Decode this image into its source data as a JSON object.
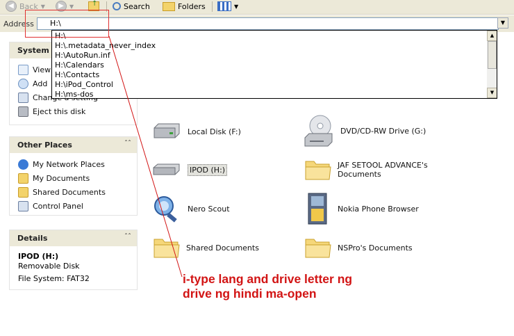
{
  "toolbar": {
    "back_label": "Back",
    "search_label": "Search",
    "folders_label": "Folders"
  },
  "address": {
    "label": "Address",
    "value": "H:\\"
  },
  "dropdown": {
    "items": [
      "H:\\",
      "H:\\.metadata_never_index",
      "H:\\AutoRun.inf",
      "H:\\Calendars",
      "H:\\Contacts",
      "H:\\iPod_Control",
      "H:\\ms-dos"
    ]
  },
  "left": {
    "system_tasks": {
      "title": "System",
      "items": [
        "View",
        "Add",
        "Change a setting",
        "Eject this disk"
      ]
    },
    "other_places": {
      "title": "Other Places",
      "items": [
        "My Network Places",
        "My Documents",
        "Shared Documents",
        "Control Panel"
      ]
    },
    "details": {
      "title": "Details",
      "name": "IPOD (H:)",
      "type": "Removable Disk",
      "fs": "File System: FAT32"
    }
  },
  "main": {
    "items": [
      {
        "label": "Local Disk (F:)",
        "icon": "hard-drive-icon"
      },
      {
        "label": "DVD/CD-RW Drive (G:)",
        "icon": "cd-drive-icon"
      },
      {
        "label": "IPOD (H:)",
        "icon": "removable-drive-icon"
      },
      {
        "label": "JAF SETOOL ADVANCE's Documents",
        "icon": "folder-icon"
      },
      {
        "label": "Nero Scout",
        "icon": "nero-scout-icon"
      },
      {
        "label": "Nokia Phone Browser",
        "icon": "nokia-phone-browser-icon"
      },
      {
        "label": "Shared Documents",
        "icon": "folder-icon"
      },
      {
        "label": "NSPro's Documents",
        "icon": "folder-icon"
      }
    ]
  },
  "annotation": {
    "line1": "i-type lang and drive letter ng",
    "line2": "drive ng hindi ma-open",
    "color": "#d21414"
  }
}
